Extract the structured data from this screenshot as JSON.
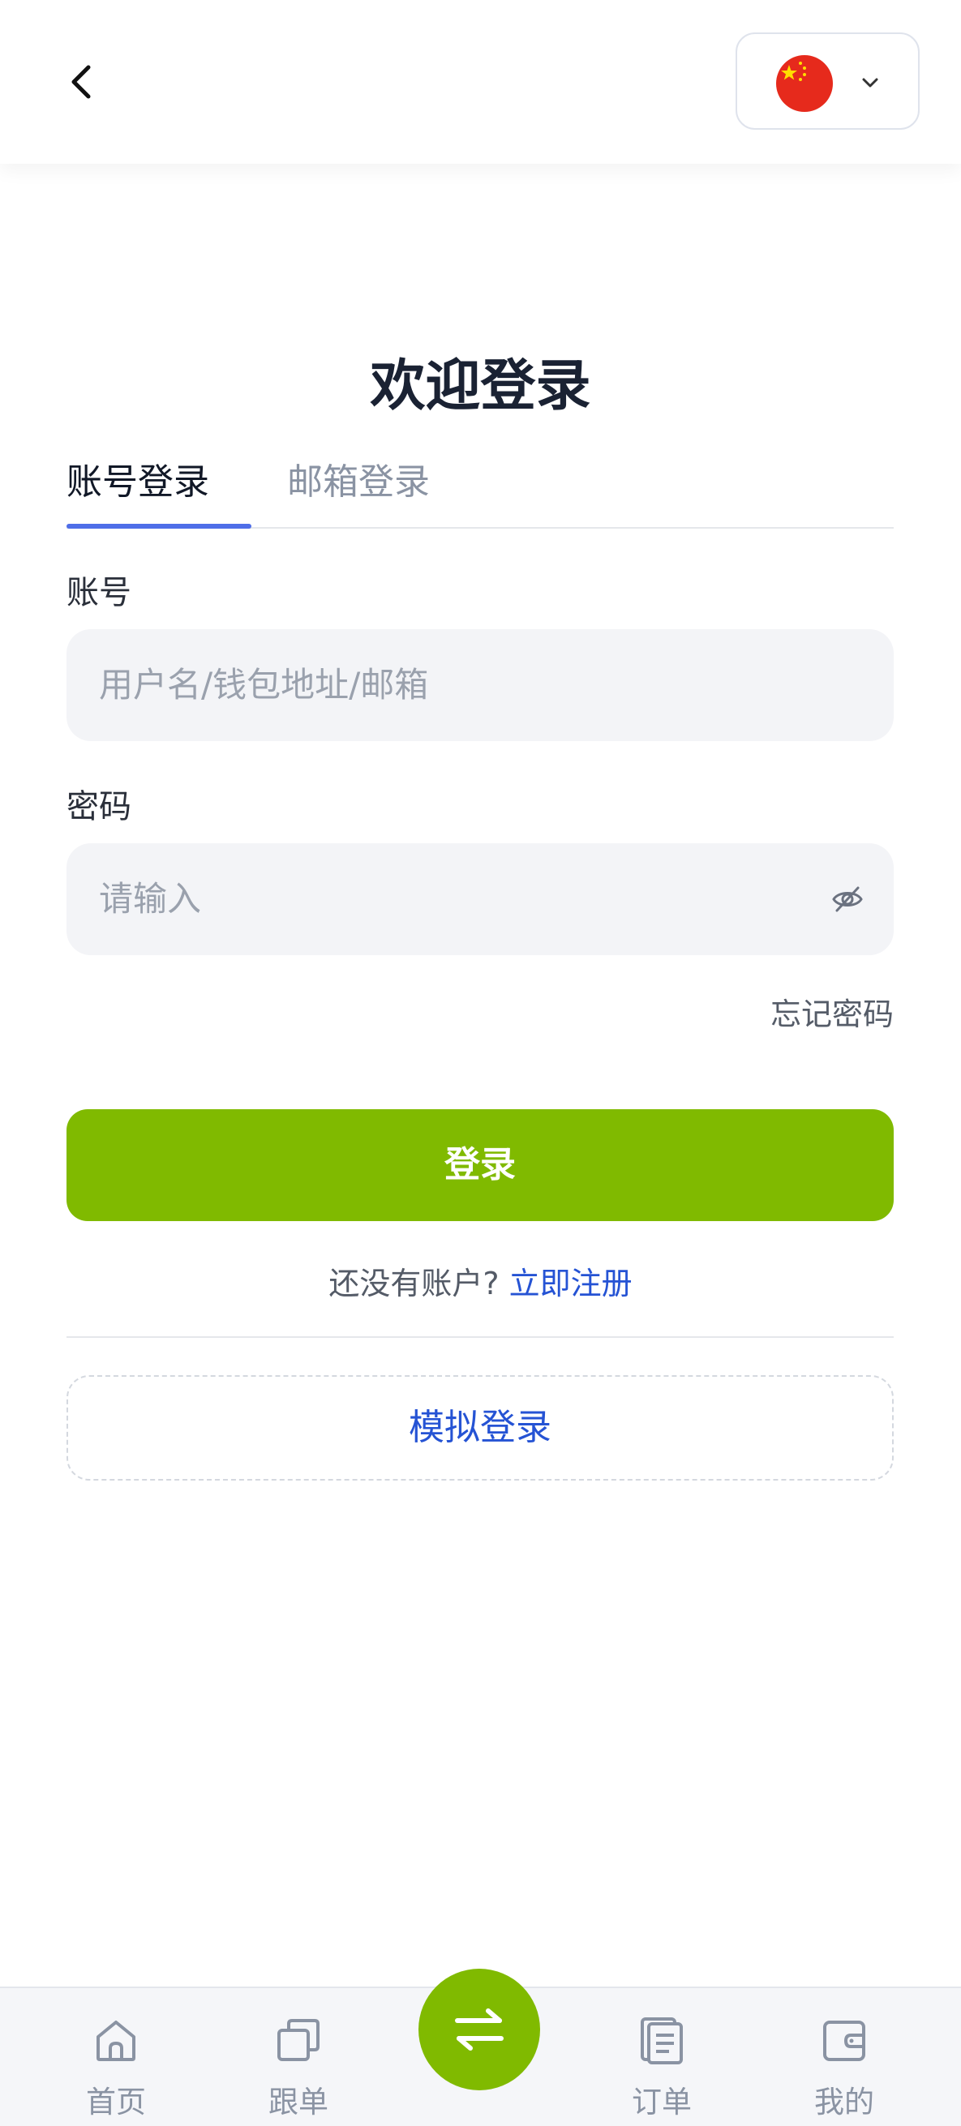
{
  "header": {
    "back_icon": "chevron-left-icon",
    "language_flag": "china-flag",
    "dropdown_icon": "chevron-down-icon"
  },
  "title": "欢迎登录",
  "tabs": [
    {
      "label": "账号登录",
      "active": true
    },
    {
      "label": "邮箱登录",
      "active": false
    }
  ],
  "form": {
    "account_label": "账号",
    "account_placeholder": "用户名/钱包地址/邮箱",
    "password_label": "密码",
    "password_placeholder": "请输入",
    "forgot_password": "忘记密码",
    "login_button": "登录",
    "no_account_text": "还没有账户?",
    "register_link": "立即注册",
    "demo_login": "模拟登录"
  },
  "tabbar": {
    "items": [
      {
        "label": "首页",
        "icon": "home-icon"
      },
      {
        "label": "跟单",
        "icon": "copy-icon"
      },
      {
        "label": "订单",
        "icon": "order-icon"
      },
      {
        "label": "我的",
        "icon": "wallet-icon"
      }
    ],
    "center_icon": "swap-icon"
  },
  "colors": {
    "primary_green": "#80ba00",
    "accent_blue": "#2553d4",
    "tab_underline": "#4f6ee8"
  }
}
